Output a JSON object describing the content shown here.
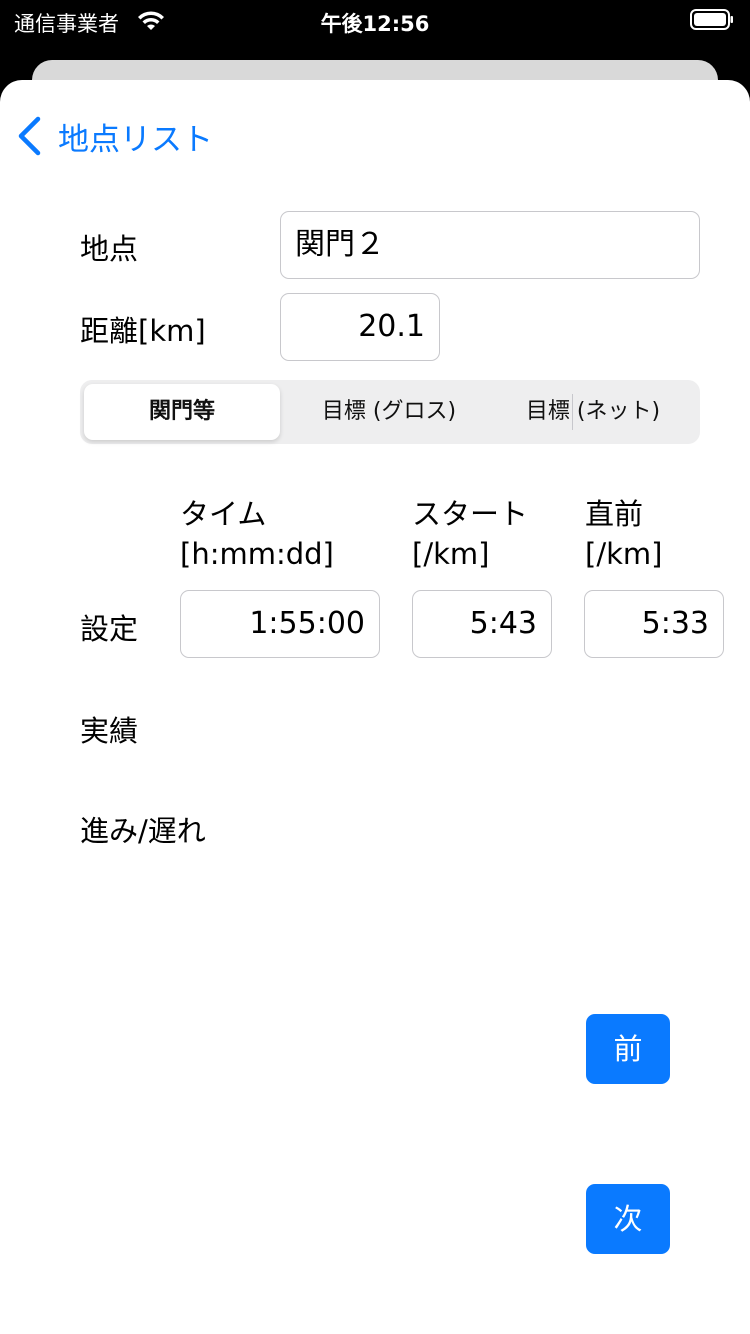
{
  "status_bar": {
    "carrier": "通信事業者",
    "time": "午後12:56"
  },
  "nav": {
    "back_label": "地点リスト"
  },
  "form": {
    "point_label": "地点",
    "point_value": "関門２",
    "distance_label": "距離[km]",
    "distance_value": "20.1"
  },
  "segments": [
    {
      "label": "関門等",
      "selected": true
    },
    {
      "label": "目標 (グロス)",
      "selected": false
    },
    {
      "label": "目標 (ネット)",
      "selected": false
    }
  ],
  "columns": {
    "time_line1": "タイム",
    "time_line2": "[h:mm:dd]",
    "start_line1": "スタート",
    "start_line2": "[/km]",
    "prev_line1": "直前",
    "prev_line2": "[/km]"
  },
  "rows": {
    "setting_label": "設定",
    "setting_time": "1:55:00",
    "setting_start": "5:43",
    "setting_prev": "5:33",
    "actual_label": "実績",
    "diff_label": "進み/遅れ"
  },
  "buttons": {
    "prev": "前",
    "next": "次"
  },
  "colors": {
    "accent": "#0a7aff"
  }
}
